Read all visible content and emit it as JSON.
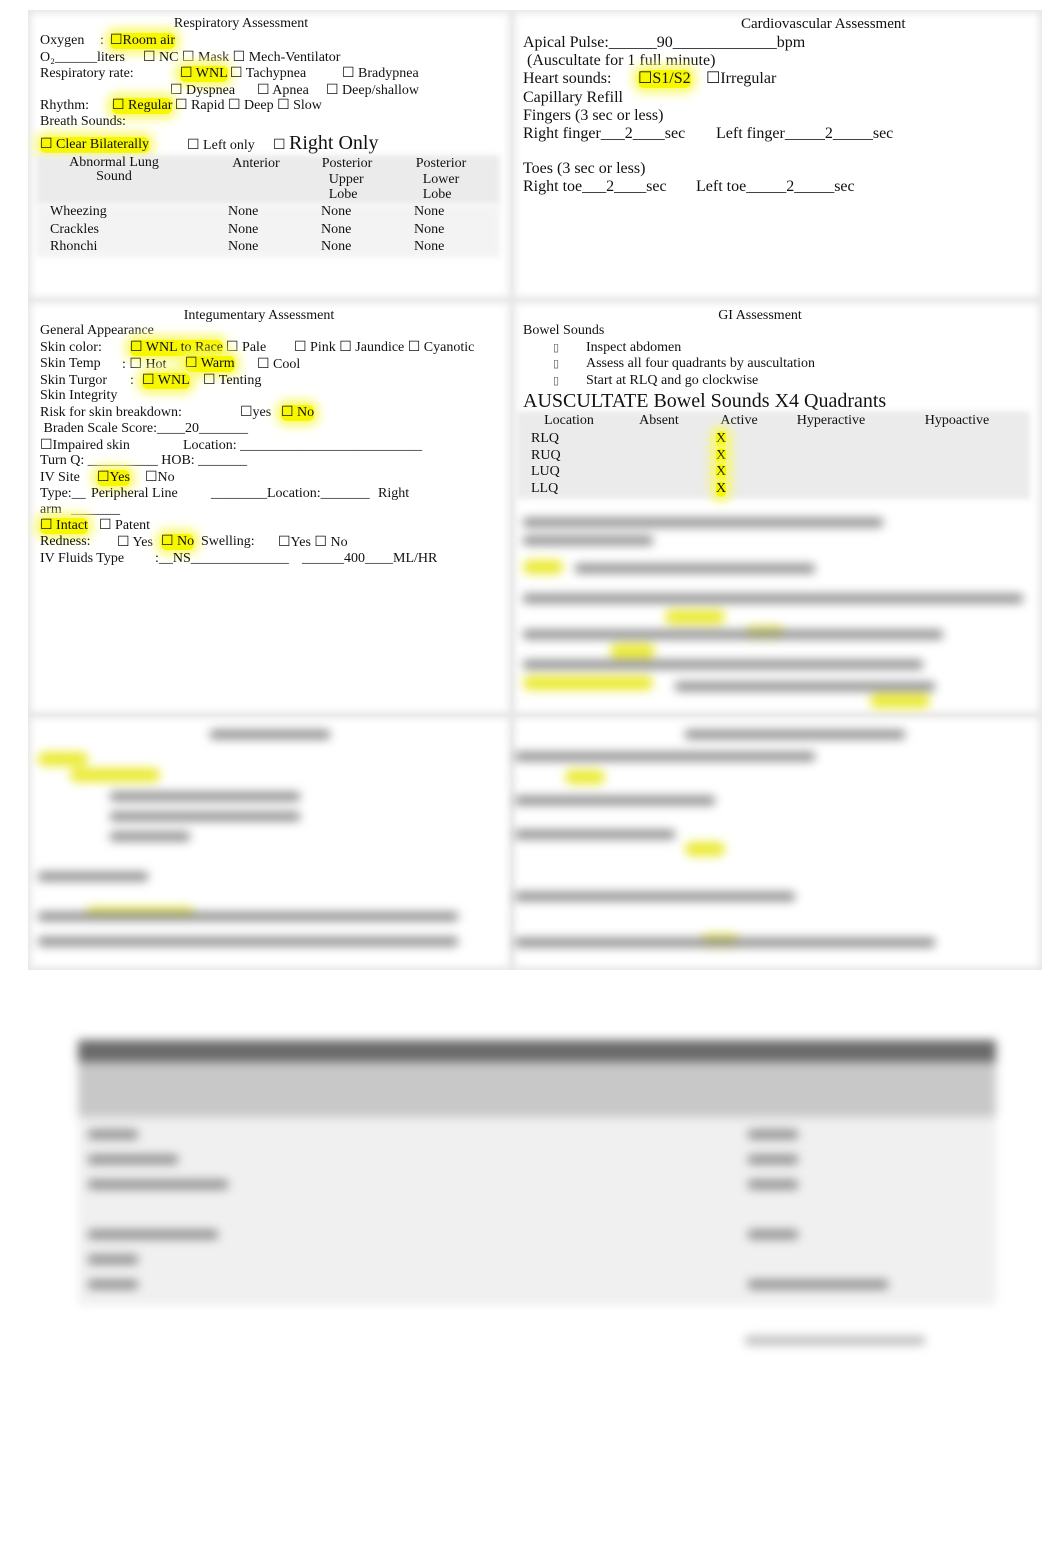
{
  "respiratory": {
    "title": "Respiratory Assessment",
    "oxygen_label": "Oxygen",
    "oxygen_colon": ":",
    "oxygen_value": "☐Room air",
    "o2_label": "O₂______liters",
    "o2_options": "☐ NC ☐ Mask ☐ Mech-Ventilator",
    "rate_label": "Respiratory rate:",
    "rate_wnl": "☐ WNL",
    "rate_tachypnea": "☐ Tachypnea",
    "rate_bradypnea": "☐ Bradypnea",
    "rate_dyspnea": "☐ Dyspnea",
    "rate_apnea": "☐ Apnea",
    "rate_deep": "☐ Deep/shallow",
    "rhythm_label": "Rhythm:",
    "rhythm_regular": "☐ Regular",
    "rhythm_others": "☐ Rapid ☐ Deep ☐ Slow",
    "breath_label": "Breath Sounds:",
    "breath_clear": "☐ Clear Bilaterally",
    "breath_left": "☐ Left only",
    "breath_right_box": "☐",
    "breath_right": "Right Only",
    "table": {
      "headers": [
        "Abnormal Lung\nSound",
        "Anterior",
        "Posterior\n  Upper\n  Lobe",
        "Posterior\n  Lower\n  Lobe"
      ],
      "rows": [
        [
          "Wheezing",
          "None",
          "None",
          "None"
        ],
        [
          "Crackles",
          "None",
          "None",
          "None"
        ],
        [
          "Rhonchi",
          "None",
          "None",
          "None"
        ]
      ]
    }
  },
  "cardio": {
    "title": "Cardiovascular Assessment",
    "apical": "Apical Pulse:______90_____________bpm",
    "auscultate": " (Auscultate for 1 full minute)",
    "heart_label": "Heart sounds:",
    "heart_s1s2": "☐S1/S2",
    "heart_irregular": "☐Irregular",
    "cap_refill": "Capillary Refill",
    "fingers": "Fingers (3 sec or less)",
    "right_finger": "Right finger___2____sec",
    "left_finger": "Left finger_____2_____sec",
    "toes": "Toes (3 sec or less)",
    "right_toe": "Right toe___2____sec",
    "left_toe": "Left toe_____2_____sec"
  },
  "integ": {
    "title": "Integumentary Assessment",
    "general": "General Appearance",
    "color_label": "Skin color:",
    "color_wnl": "☐ WNL to Race",
    "color_pale": "☐ Pale",
    "color_others": "☐ Pink ☐ Jaundice ☐ Cyanotic",
    "temp_label": "Skin Temp",
    "temp_hot": ": ☐ Hot",
    "temp_warm": "☐ Warm",
    "temp_cool": "☐ Cool",
    "turgor_label": "Skin Turgor",
    "turgor_colon": ":",
    "turgor_wnl": "☐ WNL",
    "turgor_tenting": "☐ Tenting",
    "integrity": "Skin Integrity",
    "risk_label": "Risk for skin breakdown:",
    "risk_yes": "☐yes",
    "risk_no": "☐ No",
    "braden": " Braden Scale Score:____20_______",
    "impaired": "☐Impaired skin",
    "impaired_location": "Location: __________________________",
    "turn": "Turn Q: __________ HOB: _______",
    "iv_label": "IV Site",
    "iv_yes": "☐Yes",
    "iv_no": "☐No",
    "type_label": "Type:__",
    "type_value": "Peripheral Line",
    "type_location": "________Location:_______",
    "type_right": "Right",
    "arm": "arm",
    "arm_blank": "_______",
    "intact": "☐ Intact",
    "patent": "☐ Patent",
    "redness_label": "Redness:",
    "redness_yes": "☐ Yes",
    "redness_no": "☐ No",
    "swelling_label": "Swelling:",
    "swelling_opts": "☐Yes ☐ No",
    "fluids_label": "IV Fluids Type",
    "fluids_type": ":__NS______________",
    "fluids_rate": "______400____ML/HR"
  },
  "gi": {
    "title": "GI Assessment",
    "bowel": "Bowel Sounds",
    "bullet_glyph": "▯",
    "bullets": [
      "Inspect abdomen",
      "Assess all four quadrants by auscultation",
      "Start at RLQ and go clockwise"
    ],
    "auscultate": "AUSCULTATE Bowel Sounds X4 Quadrants",
    "table": {
      "headers": [
        "Location",
        "Absent",
        "Active",
        "Hyperactive",
        "Hypoactive"
      ],
      "rows": [
        [
          "RLQ",
          "",
          "X",
          "",
          ""
        ],
        [
          "RUQ",
          "",
          "X",
          "",
          ""
        ],
        [
          "LUQ",
          "",
          "X",
          "",
          ""
        ],
        [
          "LLQ",
          "",
          "X",
          "",
          ""
        ]
      ]
    }
  },
  "colors": {
    "highlight": "#f7f700",
    "table_band": "#ebebeb"
  }
}
